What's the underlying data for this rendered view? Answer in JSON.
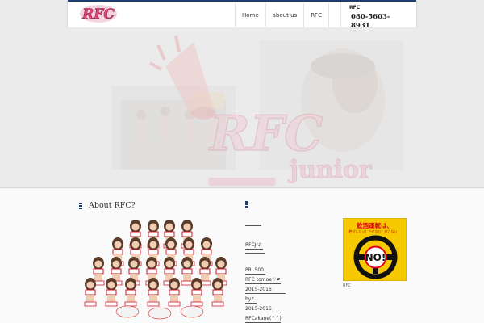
{
  "header": {
    "logo_text": "RFC",
    "nav": [
      {
        "label": "Home"
      },
      {
        "label": "about us"
      },
      {
        "label": "RFC"
      }
    ],
    "contact_label": "RFC",
    "phone": "080-5603-8931"
  },
  "hero": {
    "logo_text": "RFC",
    "junior_text": "junior",
    "megaphone_text": "",
    "subtitle": ""
  },
  "about": {
    "title": "About RFC?"
  },
  "links_widget": {
    "items": [
      {
        "label": "RFCJr♪"
      },
      {
        "label": "PR: 500　"
      },
      {
        "label": "RFC tomoe♡❤"
      },
      {
        "label": "2015-2016　　"
      },
      {
        "label": "by♪"
      },
      {
        "label": "2015-2016　　"
      },
      {
        "label": "RFCakane(^^)"
      }
    ]
  },
  "banner": {
    "top_text": "飲酒運転は、",
    "sub_text": "絶対しない！させない！許さない！",
    "no_text": "NO!",
    "caption": "RFC"
  },
  "colors": {
    "brand_navy": "#1c3d6e",
    "logo_pink": "#e0457b",
    "banner_yellow": "#f7c900",
    "banner_red": "#e0001a"
  }
}
